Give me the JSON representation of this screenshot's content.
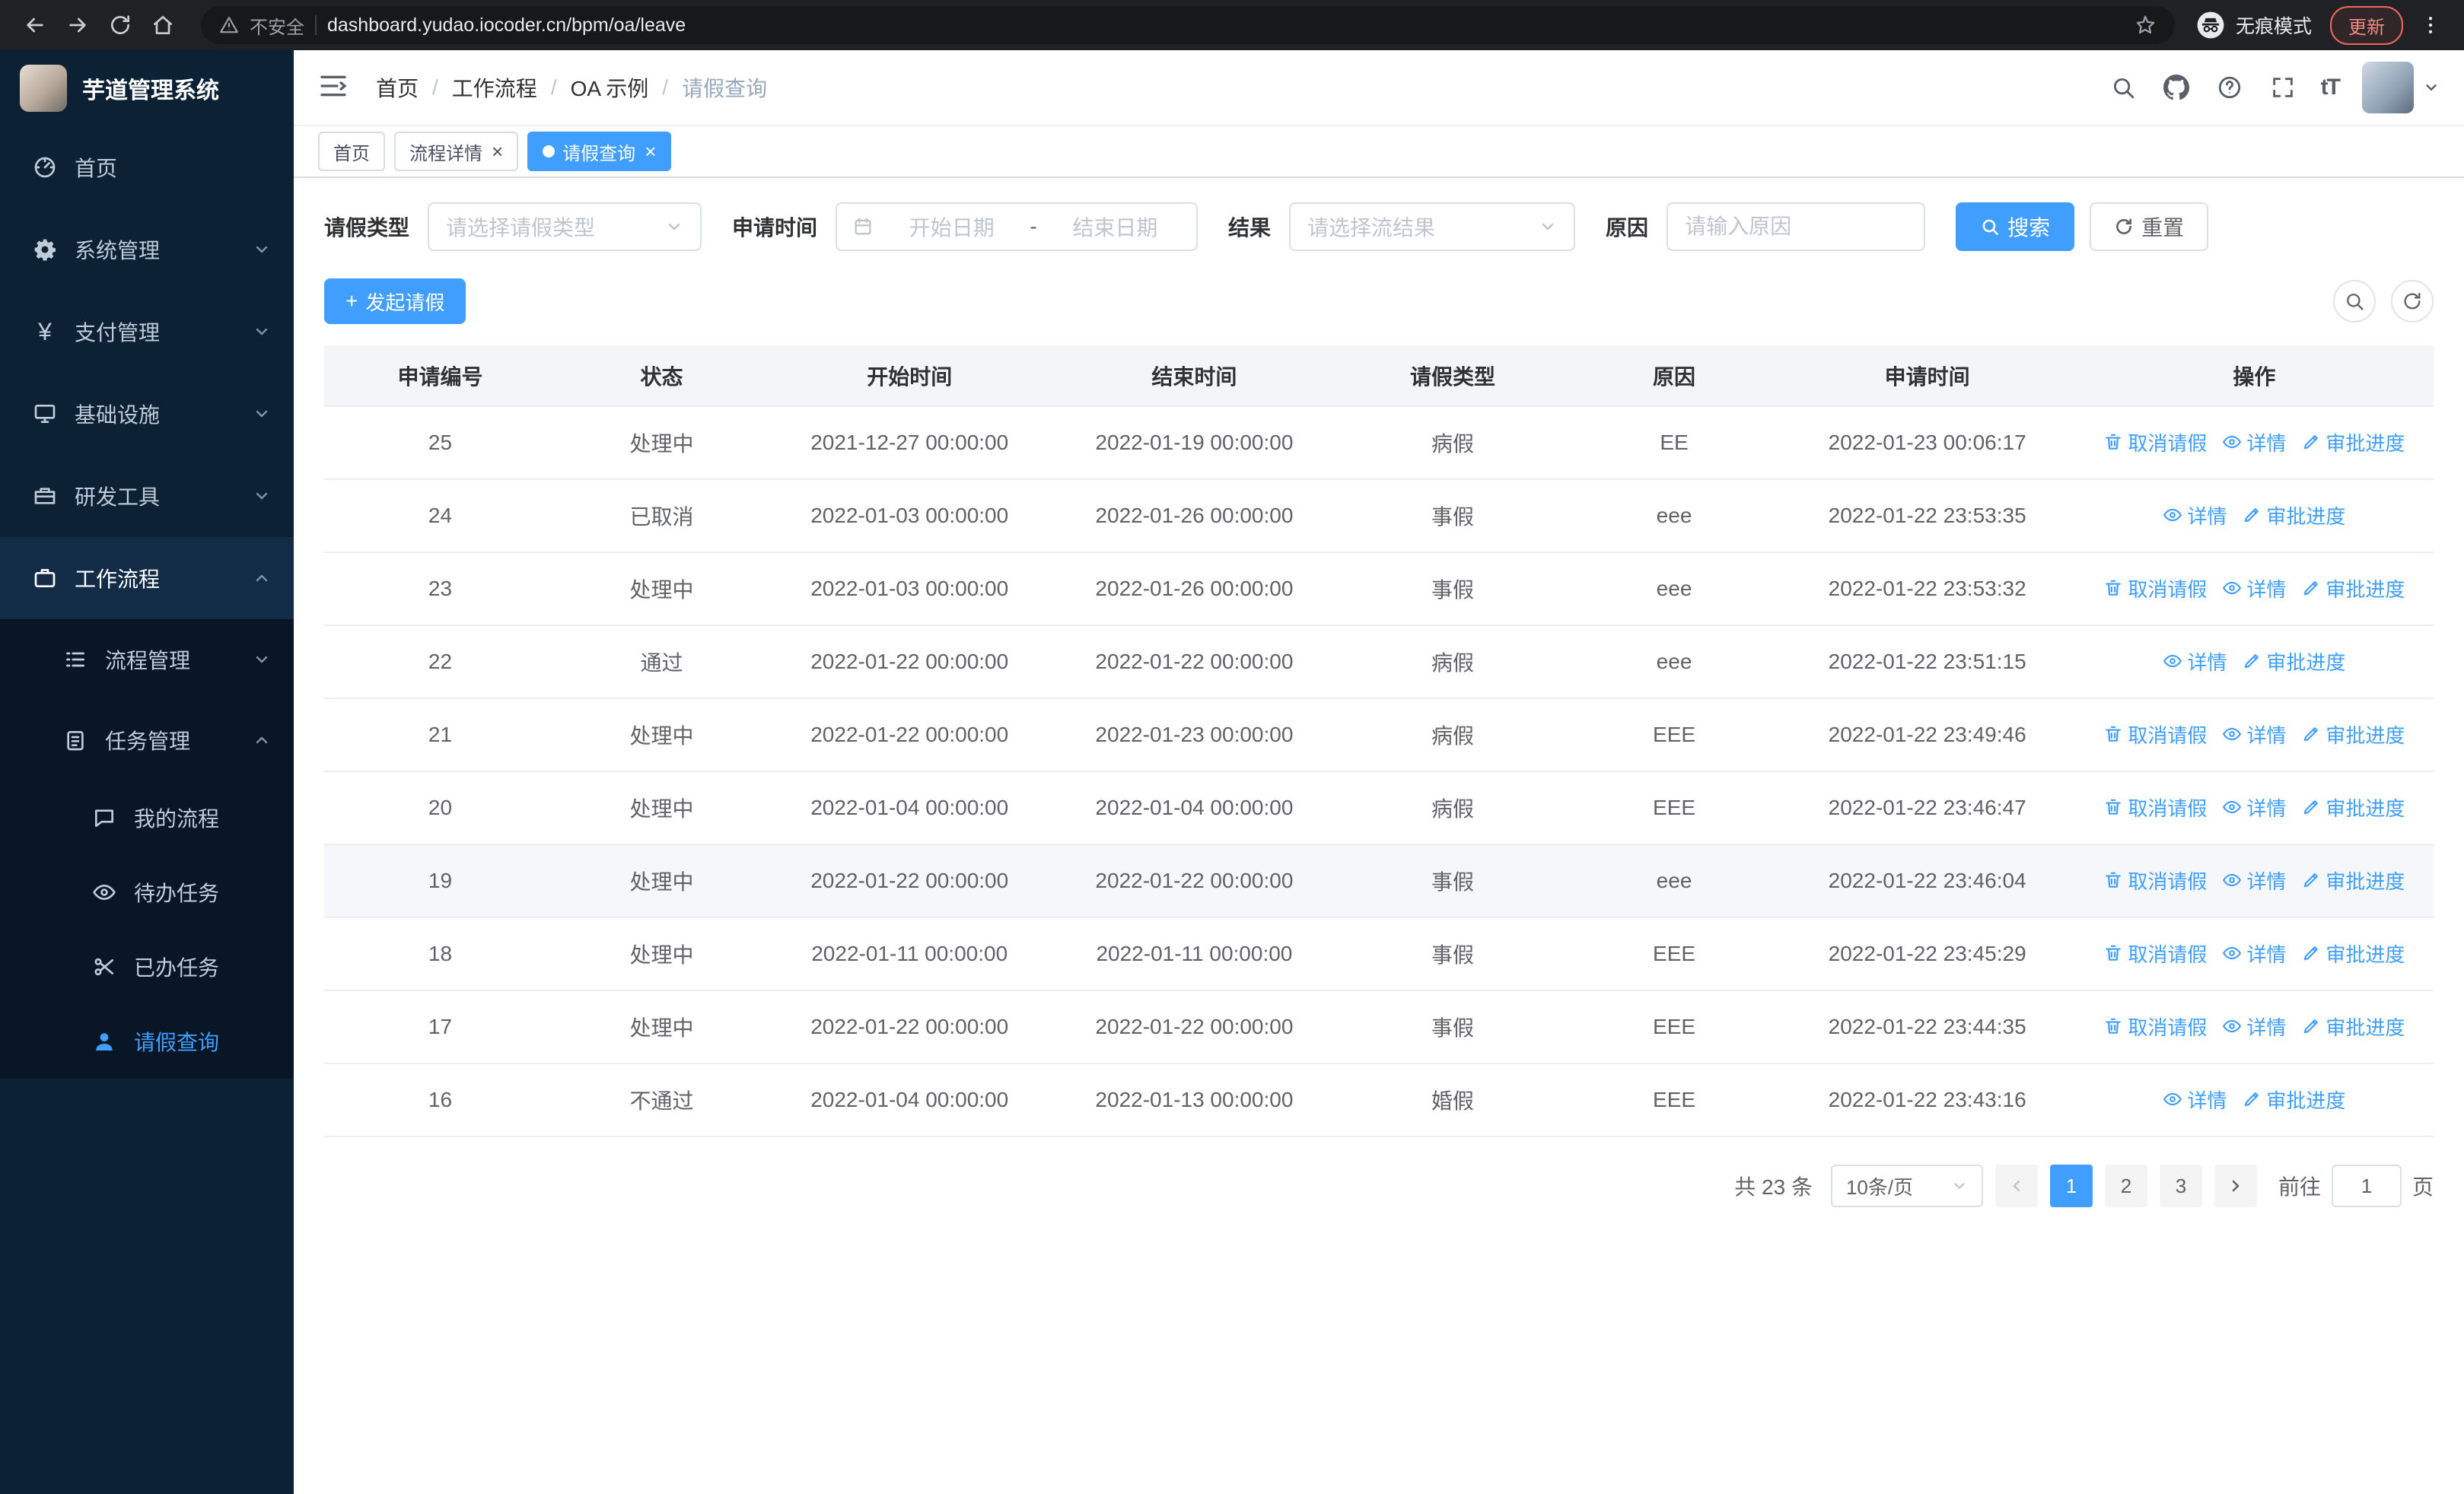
{
  "browser": {
    "security_label": "不安全",
    "url": "dashboard.yudao.iocoder.cn/bpm/oa/leave",
    "incognito_label": "无痕模式",
    "update_label": "更新"
  },
  "sidebar": {
    "logo_title": "芋道管理系统",
    "items": [
      {
        "label": "首页",
        "icon": "dashboard-icon"
      },
      {
        "label": "系统管理",
        "icon": "gear-icon"
      },
      {
        "label": "支付管理",
        "icon": "yen-icon"
      },
      {
        "label": "基础设施",
        "icon": "monitor-icon"
      },
      {
        "label": "研发工具",
        "icon": "toolbox-icon"
      },
      {
        "label": "工作流程",
        "icon": "briefcase-icon"
      },
      {
        "label": "流程管理",
        "icon": "list-icon"
      },
      {
        "label": "任务管理",
        "icon": "clipboard-icon"
      },
      {
        "label": "我的流程",
        "icon": "chat-icon"
      },
      {
        "label": "待办任务",
        "icon": "eye-icon"
      },
      {
        "label": "已办任务",
        "icon": "scissors-icon"
      },
      {
        "label": "请假查询",
        "icon": "user-icon"
      }
    ]
  },
  "header": {
    "breadcrumb": [
      "首页",
      "工作流程",
      "OA 示例",
      "请假查询"
    ],
    "separator": "/",
    "font_size_glyph": "tT"
  },
  "tabs": [
    {
      "label": "首页",
      "closable": false,
      "active": false
    },
    {
      "label": "流程详情",
      "closable": true,
      "active": false
    },
    {
      "label": "请假查询",
      "closable": true,
      "active": true
    }
  ],
  "filters": {
    "leave_type_label": "请假类型",
    "leave_type_placeholder": "请选择请假类型",
    "apply_time_label": "申请时间",
    "date_start_placeholder": "开始日期",
    "date_separator": "-",
    "date_end_placeholder": "结束日期",
    "result_label": "结果",
    "result_placeholder": "请选择流结果",
    "reason_label": "原因",
    "reason_placeholder": "请输入原因",
    "search_button": "搜索",
    "reset_button": "重置"
  },
  "toolbar": {
    "create_button": "发起请假"
  },
  "table": {
    "columns": [
      "申请编号",
      "状态",
      "开始时间",
      "结束时间",
      "请假类型",
      "原因",
      "申请时间",
      "操作"
    ],
    "action_labels": {
      "cancel": "取消请假",
      "detail": "详情",
      "progress": "审批进度"
    },
    "rows": [
      {
        "id": "25",
        "status": "处理中",
        "start": "2021-12-27 00:00:00",
        "end": "2022-01-19 00:00:00",
        "type": "病假",
        "reason": "EE",
        "applied": "2022-01-23 00:06:17",
        "actions": [
          "cancel",
          "detail",
          "progress"
        ],
        "hover": false
      },
      {
        "id": "24",
        "status": "已取消",
        "start": "2022-01-03 00:00:00",
        "end": "2022-01-26 00:00:00",
        "type": "事假",
        "reason": "eee",
        "applied": "2022-01-22 23:53:35",
        "actions": [
          "detail",
          "progress"
        ],
        "hover": false
      },
      {
        "id": "23",
        "status": "处理中",
        "start": "2022-01-03 00:00:00",
        "end": "2022-01-26 00:00:00",
        "type": "事假",
        "reason": "eee",
        "applied": "2022-01-22 23:53:32",
        "actions": [
          "cancel",
          "detail",
          "progress"
        ],
        "hover": false
      },
      {
        "id": "22",
        "status": "通过",
        "start": "2022-01-22 00:00:00",
        "end": "2022-01-22 00:00:00",
        "type": "病假",
        "reason": "eee",
        "applied": "2022-01-22 23:51:15",
        "actions": [
          "detail",
          "progress"
        ],
        "hover": false
      },
      {
        "id": "21",
        "status": "处理中",
        "start": "2022-01-22 00:00:00",
        "end": "2022-01-23 00:00:00",
        "type": "病假",
        "reason": "EEE",
        "applied": "2022-01-22 23:49:46",
        "actions": [
          "cancel",
          "detail",
          "progress"
        ],
        "hover": false
      },
      {
        "id": "20",
        "status": "处理中",
        "start": "2022-01-04 00:00:00",
        "end": "2022-01-04 00:00:00",
        "type": "病假",
        "reason": "EEE",
        "applied": "2022-01-22 23:46:47",
        "actions": [
          "cancel",
          "detail",
          "progress"
        ],
        "hover": false
      },
      {
        "id": "19",
        "status": "处理中",
        "start": "2022-01-22 00:00:00",
        "end": "2022-01-22 00:00:00",
        "type": "事假",
        "reason": "eee",
        "applied": "2022-01-22 23:46:04",
        "actions": [
          "cancel",
          "detail",
          "progress"
        ],
        "hover": true
      },
      {
        "id": "18",
        "status": "处理中",
        "start": "2022-01-11 00:00:00",
        "end": "2022-01-11 00:00:00",
        "type": "事假",
        "reason": "EEE",
        "applied": "2022-01-22 23:45:29",
        "actions": [
          "cancel",
          "detail",
          "progress"
        ],
        "hover": false
      },
      {
        "id": "17",
        "status": "处理中",
        "start": "2022-01-22 00:00:00",
        "end": "2022-01-22 00:00:00",
        "type": "事假",
        "reason": "EEE",
        "applied": "2022-01-22 23:44:35",
        "actions": [
          "cancel",
          "detail",
          "progress"
        ],
        "hover": false
      },
      {
        "id": "16",
        "status": "不通过",
        "start": "2022-01-04 00:00:00",
        "end": "2022-01-13 00:00:00",
        "type": "婚假",
        "reason": "EEE",
        "applied": "2022-01-22 23:43:16",
        "actions": [
          "detail",
          "progress"
        ],
        "hover": false
      }
    ]
  },
  "pagination": {
    "total_text": "共 23 条",
    "page_size": "10条/页",
    "pages": [
      "1",
      "2",
      "3"
    ],
    "active_page": "1",
    "goto_label": "前往",
    "goto_value": "1",
    "goto_suffix": "页"
  },
  "colors": {
    "primary": "#409eff",
    "sidebar_bg": "#0d2135",
    "sidebar_submenu_bg": "#081626",
    "active_tag_bg": "#409eff",
    "table_header_bg": "#f4f5f7",
    "chrome_bg": "#202124",
    "update_badge": "#f28b82"
  }
}
